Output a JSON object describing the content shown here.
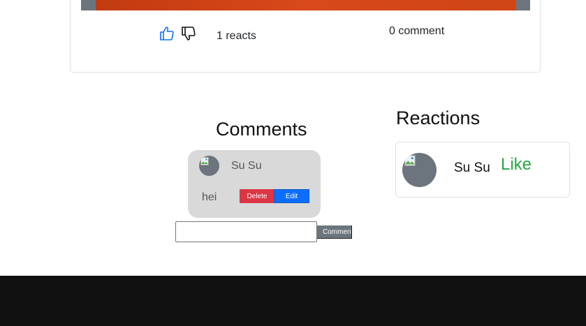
{
  "post": {
    "reacts_count": "1 reacts",
    "comment_count": "0 comment",
    "image_color": "#d8481a"
  },
  "comments": {
    "heading": "Comments",
    "items": [
      {
        "author": "Su Su",
        "text": "hei",
        "delete_label": "Delete",
        "edit_label": "Edit"
      }
    ],
    "input_value": "",
    "submit_label": "Comment"
  },
  "reactions": {
    "heading": "Reactions",
    "items": [
      {
        "user": "Su Su",
        "type": "Like"
      }
    ]
  },
  "colors": {
    "like": "#28a745",
    "delete": "#dc3545",
    "edit": "#0d6efd",
    "footer": "#121112"
  },
  "icons": {
    "like": "thumbs-up-icon",
    "dislike": "thumbs-down-icon"
  }
}
